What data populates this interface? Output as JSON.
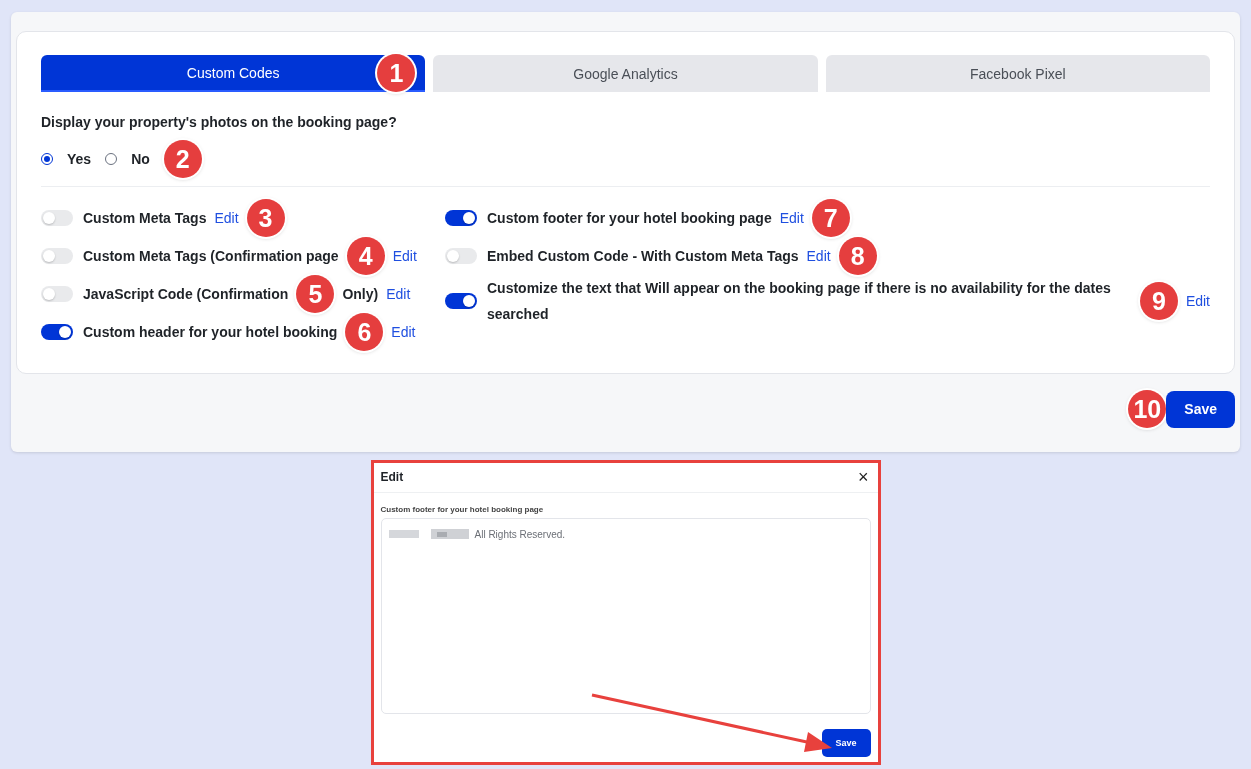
{
  "tabs": [
    {
      "label": "Custom Codes",
      "selected": true,
      "callout": "1"
    },
    {
      "label": "Google Analytics",
      "selected": false
    },
    {
      "label": "Facebook Pixel",
      "selected": false
    }
  ],
  "photos_question": {
    "label": "Display your property's photos on the booking page?",
    "options": [
      {
        "label": "Yes",
        "selected": true
      },
      {
        "label": "No",
        "selected": false
      }
    ],
    "callout": "2"
  },
  "settings_left": [
    {
      "on": false,
      "label": "Custom Meta Tags",
      "edit": "Edit",
      "callout": "3",
      "kind": "trailing"
    },
    {
      "on": false,
      "label": "Custom Meta Tags (Confirmation page",
      "edit": "Edit",
      "callout": "4",
      "kind": "inline"
    },
    {
      "on": false,
      "label": "JavaScript Code (Confirmation",
      "label_rest": "Only)",
      "edit": "Edit",
      "callout": "5",
      "kind": "inline"
    },
    {
      "on": true,
      "label": "Custom header for your hotel booking",
      "edit": "Edit",
      "callout": "6",
      "kind": "inline"
    }
  ],
  "settings_right": [
    {
      "on": true,
      "label": "Custom footer for your hotel booking page",
      "edit": "Edit",
      "callout": "7",
      "kind": "trailing"
    },
    {
      "on": false,
      "label": "Embed Custom Code - With Custom Meta Tags",
      "edit": "Edit",
      "callout": "8",
      "kind": "trailing"
    },
    {
      "on": true,
      "label": "Customize the text that Will appear on the booking page if there is no availability for the dates searched",
      "edit": "Edit",
      "callout": "9",
      "kind": "inline"
    }
  ],
  "save": {
    "label": "Save",
    "callout": "10"
  },
  "modal": {
    "title": "Edit",
    "close": "×",
    "field_label": "Custom footer for your hotel booking page",
    "value": "All Rights Reserved.",
    "save": "Save"
  }
}
